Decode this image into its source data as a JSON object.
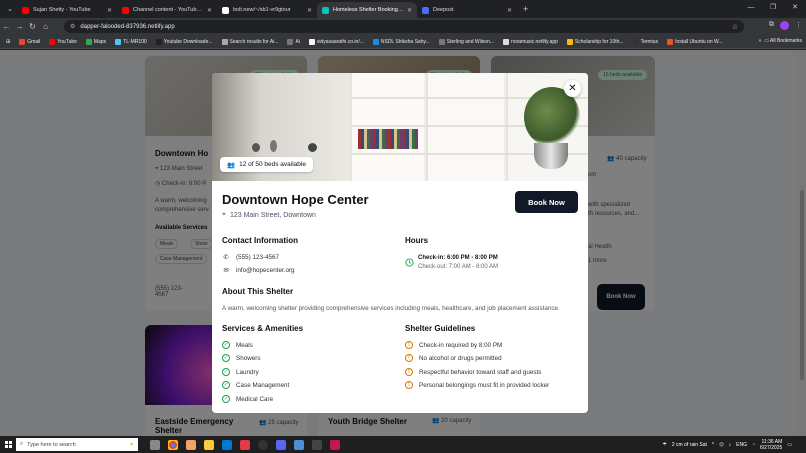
{
  "browser": {
    "tabs": [
      {
        "label": "Sujan Shetty - YouTube",
        "color": "#ff0000",
        "active": false
      },
      {
        "label": "Channel content - YouTube St",
        "color": "#ff0000",
        "active": false
      },
      {
        "label": "bolt.new/~/sb1-vr9gtour",
        "color": "#ffffff",
        "active": false
      },
      {
        "label": "Homeless Shelter Booking Wi",
        "color": "#00c7b7",
        "active": true
      },
      {
        "label": "Deepost",
        "color": "#4d6bfe",
        "active": false
      }
    ],
    "url": "dapper-falooded-837936.netlify.app",
    "bookmarks": [
      "Gmail",
      "YouTube",
      "Maps",
      "TL-MR100",
      "Youtube Downloade...",
      "Search results for Ai...",
      "Ai",
      "vidyasaarathi.co.in/...",
      "NSDL Shiksha Sahy...",
      "Sterling and Wilson...",
      "noramusic.netlify.app",
      "Scholarship for 10th...",
      "Termius",
      "Install Ubuntu on W..."
    ],
    "all_bookmarks": "All Bookmarks"
  },
  "background_cards": {
    "left": {
      "badge": "12 beds available",
      "title": "Downtown Ho",
      "address": "123 Main Street",
      "checkin": "Check-in: 6:00 P",
      "desc1": "A warm, welcoming",
      "desc2": "comprehensive serv",
      "services_label": "Available Services",
      "chips": [
        "Meals",
        "Show",
        "Case Management"
      ],
      "phone": "(555) 123-4567"
    },
    "middle": {
      "badge": "8 beds available"
    },
    "right": {
      "badge": "15 beds available",
      "capacity": "40 capacity",
      "line1": "om",
      "desc1": "with specialized",
      "desc2": "th resources, and...",
      "chip": "al Health",
      "more": "1 more",
      "book": "Book Now"
    },
    "bottom_left": {
      "title": "Eastside Emergency Shelter",
      "capacity": "25 capacity"
    },
    "bottom_middle": {
      "title": "Youth Bridge Shelter",
      "capacity": "20 capacity"
    }
  },
  "modal": {
    "beds_pill": "12 of 50 beds available",
    "title": "Downtown Hope Center",
    "address": "123 Main Street, Downtown",
    "book_button": "Book Now",
    "contact": {
      "heading": "Contact Information",
      "phone": "(555) 123-4567",
      "email": "info@hopecenter.org"
    },
    "hours": {
      "heading": "Hours",
      "checkin": "Check-in: 6:00 PM - 8:00 PM",
      "checkout": "Check-out: 7:00 AM - 8:00 AM"
    },
    "about": {
      "heading": "About This Shelter",
      "text": "A warm, welcoming shelter providing comprehensive services including meals, healthcare, and job placement assistance."
    },
    "amenities": {
      "heading": "Services & Amenities",
      "items": [
        "Meals",
        "Showers",
        "Laundry",
        "Case Management",
        "Medical Care"
      ]
    },
    "guidelines": {
      "heading": "Shelter Guidelines",
      "items": [
        "Check-in required by 8:00 PM",
        "No alcohol or drugs permitted",
        "Respectful behavior toward staff and guests",
        "Personal belongings must fit in provided locker"
      ]
    }
  },
  "taskbar": {
    "search_placeholder": "Type here to search",
    "weather": "2 cm of rain Sat",
    "lang": "ENG",
    "time": "11:36 AM",
    "date": "6/27/2025"
  },
  "colors": {
    "accent": "#111827",
    "success": "#16a34a",
    "warning": "#d97706"
  }
}
